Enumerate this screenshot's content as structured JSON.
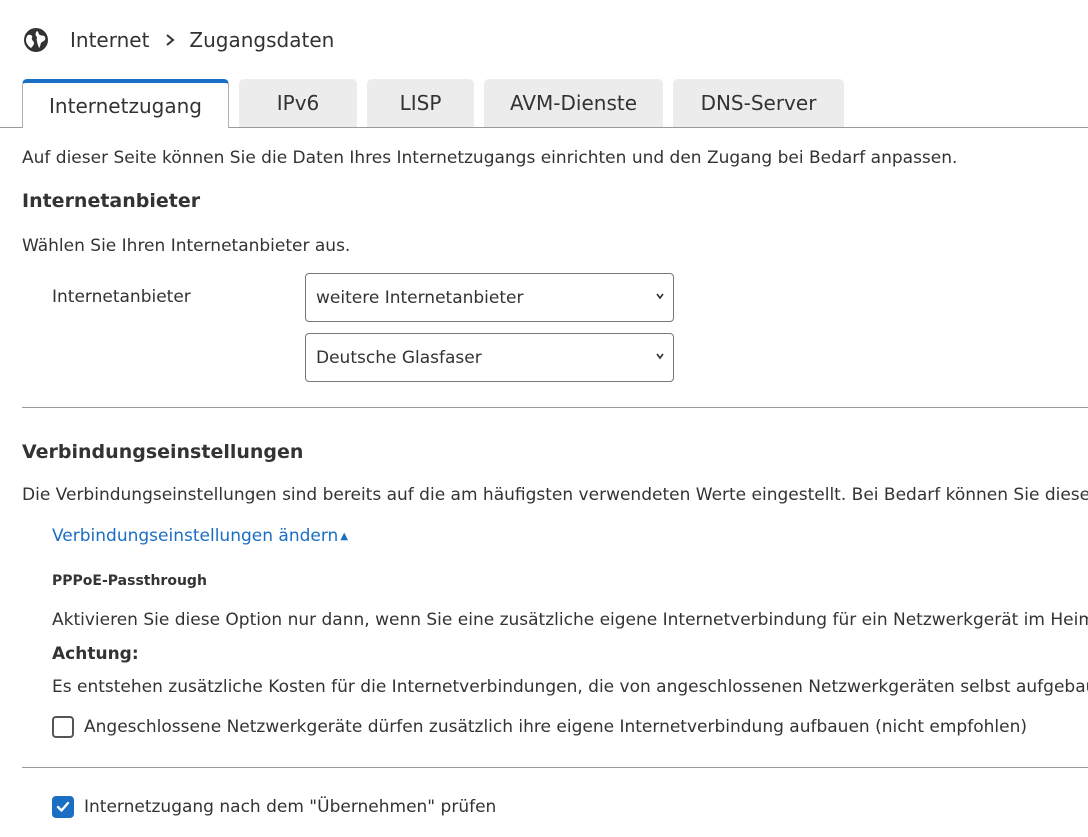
{
  "breadcrumb": {
    "icon": "globe-icon",
    "items": [
      "Internet",
      "Zugangsdaten"
    ]
  },
  "tabs": [
    {
      "label": "Internetzugang",
      "active": true
    },
    {
      "label": "IPv6",
      "active": false
    },
    {
      "label": "LISP",
      "active": false
    },
    {
      "label": "AVM-Dienste",
      "active": false
    },
    {
      "label": "DNS-Server",
      "active": false
    }
  ],
  "intro": "Auf dieser Seite können Sie die Daten Ihres Internetzugangs einrichten und den Zugang bei Bedarf anpassen.",
  "provider_section": {
    "title": "Internetanbieter",
    "description": "Wählen Sie Ihren Internetanbieter aus.",
    "field_label": "Internetanbieter",
    "select_1_value": "weitere Internetanbieter",
    "select_2_value": "Deutsche Glasfaser"
  },
  "connection_section": {
    "title": "Verbindungseinstellungen",
    "description": "Die Verbindungseinstellungen sind bereits auf die am häufigsten verwendeten Werte eingestellt. Bei Bedarf können Sie diese W",
    "toggle_link": "Verbindungseinstellungen ändern",
    "pppoe_title": "PPPoE-Passthrough",
    "pppoe_text": "Aktivieren Sie diese Option nur dann, wenn Sie eine zusätzliche eigene Internetverbindung für ein Netzwerkgerät im Heimn",
    "warning_label": "Achtung:",
    "warning_text": "Es entstehen zusätzliche Kosten für die Internetverbindungen, die von angeschlossenen Netzwerkgeräten selbst aufgebaut",
    "checkbox_passthrough_label": "Angeschlossene Netzwerkgeräte dürfen zusätzlich ihre eigene Internetverbindung aufbauen (nicht empfohlen)",
    "checkbox_passthrough_checked": false
  },
  "verify": {
    "label": "Internetzugang nach dem \"Übernehmen\" prüfen",
    "checked": true
  },
  "colors": {
    "accent": "#1a6fc4",
    "tab_bg": "#ececec",
    "text": "#333333"
  }
}
